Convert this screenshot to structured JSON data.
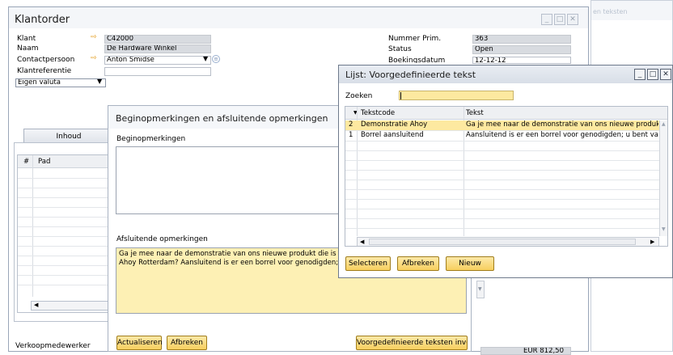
{
  "main": {
    "title": "Klantorder",
    "left_fields": [
      {
        "label": "Klant",
        "value": "C42000",
        "arrow": true
      },
      {
        "label": "Naam",
        "value": "De Hardware Winkel",
        "arrow": false
      },
      {
        "label": "Contactpersoon",
        "value": "Anton Smidse",
        "arrow": true
      },
      {
        "label": "Klantreferentie",
        "value": "",
        "arrow": false
      }
    ],
    "currency_select": "Eigen valuta",
    "right_fields": [
      {
        "label": "Nummer Prim.",
        "value": "363"
      },
      {
        "label": "Status",
        "value": "Open"
      },
      {
        "label": "Boekingsdatum",
        "value": "12-12-12"
      }
    ],
    "tab_label": "Inhoud",
    "grid_headers": [
      "#",
      "Pad"
    ],
    "sales_employee_label": "Verkoopmedewerker",
    "total_value": "EUR 812,50"
  },
  "remarks": {
    "title": "Beginopmerkingen en afsluitende opmerkingen",
    "opening_label": "Beginopmerkingen",
    "opening_text": "",
    "closing_label": "Afsluitende opmerkingen",
    "closing_text_line1": "Ga je mee naar de demonstratie van ons nieuwe produkt die is te",
    "closing_text_line2": "Ahoy Rotterdam? Aansluitend is er een borrel voor genodigden; u",
    "update_button": "Actualiseren",
    "cancel_button": "Afbreken",
    "insert_button": "Voorgedefinieerde teksten invoe"
  },
  "list": {
    "title": "Lijst: Voorgedefinieerde tekst",
    "search_label": "Zoeken",
    "search_value": "",
    "col_code": "Tekstcode",
    "col_text": "Tekst",
    "rows": [
      {
        "num": "2",
        "code": "Demonstratie Ahoy",
        "text": "Ga je mee naar de demonstratie van ons nieuwe produkt d"
      },
      {
        "num": "1",
        "code": "Borrel aansluitend",
        "text": "Aansluitend is er een borrel voor genodigden; u bent van h"
      }
    ],
    "select_button": "Selecteren",
    "cancel_button": "Afbreken",
    "new_button": "Nieuw"
  },
  "background_window": {
    "title_fragment": "en teksten"
  },
  "colors": {
    "accent": "#f7cf5f",
    "selected_row": "#fde9a0",
    "field_gray": "#d8dbe0",
    "notes_yellow": "#fdf0b4"
  }
}
